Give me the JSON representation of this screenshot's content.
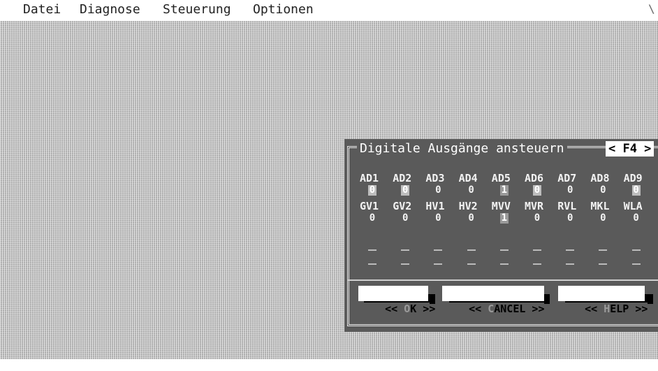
{
  "menu": [
    {
      "label": "Datei"
    },
    {
      "label": "Diagnose"
    },
    {
      "label": "Steuerung"
    },
    {
      "label": "Optionen"
    }
  ],
  "dialog": {
    "title": "Digitale Ausgänge ansteuern",
    "hotkey": "< F4 >",
    "rows": [
      {
        "labels": [
          "AD1",
          "AD2",
          "AD3",
          "AD4",
          "AD5",
          "AD6",
          "AD7",
          "AD8",
          "AD9"
        ],
        "values": [
          "0",
          "0",
          "0",
          "0",
          "1",
          "0",
          "0",
          "0",
          "0"
        ]
      },
      {
        "labels": [
          "GV1",
          "GV2",
          "HV1",
          "HV2",
          "MVV",
          "MVR",
          "RVL",
          "MKL",
          "WLA"
        ],
        "values": [
          "0",
          "0",
          "0",
          "0",
          "1",
          "0",
          "0",
          "0",
          "0"
        ]
      }
    ],
    "buttons": {
      "ok": {
        "prefix": "<< ",
        "hot": "O",
        "rest": "K",
        "suffix": " >>"
      },
      "cancel": {
        "prefix": "<< ",
        "hot": "C",
        "rest": "ANCEL",
        "suffix": " >>"
      },
      "help": {
        "prefix": "<< ",
        "hot": "H",
        "rest": "ELP",
        "suffix": " >>"
      }
    }
  }
}
